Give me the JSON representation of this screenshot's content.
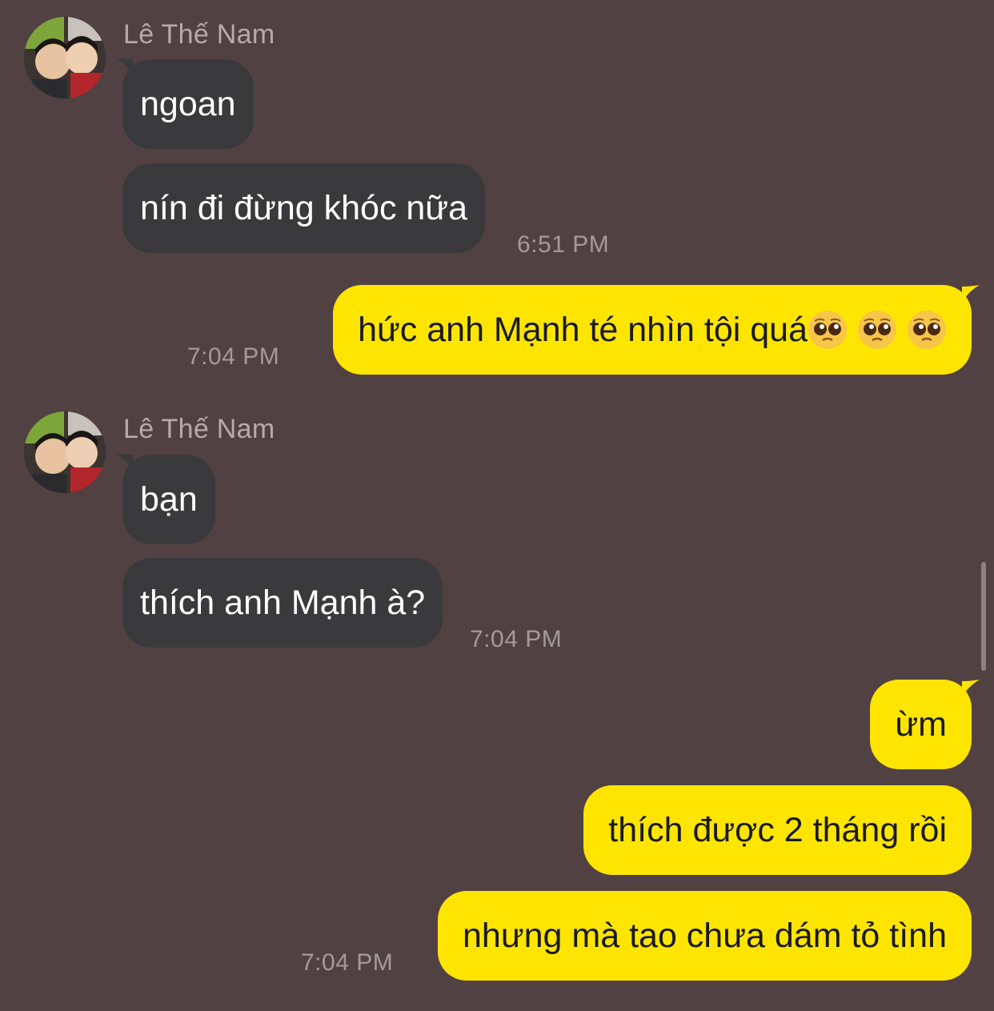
{
  "sender": {
    "name": "Lê Thế Nam"
  },
  "messages": [
    {
      "dir": "in",
      "text": "ngoan"
    },
    {
      "dir": "in",
      "text": "nín đi đừng khóc nữa",
      "time": "6:51 PM"
    },
    {
      "dir": "out",
      "text": "hức anh Mạnh té nhìn tội quá",
      "emoji": [
        "pleading-face",
        "pleading-face",
        "pleading-face"
      ],
      "time": "7:04 PM"
    },
    {
      "dir": "in",
      "text": "bạn"
    },
    {
      "dir": "in",
      "text": "thích anh Mạnh à?",
      "time": "7:04 PM"
    },
    {
      "dir": "out",
      "text": "ừm"
    },
    {
      "dir": "out",
      "text": "thích được 2 tháng rồi"
    },
    {
      "dir": "out",
      "text": "nhưng mà tao chưa dám tỏ tình",
      "time": "7:04 PM"
    }
  ],
  "colors": {
    "background": "#524142",
    "incoming_bubble": "#3a3a3c",
    "outgoing_bubble": "#fee500",
    "timestamp": "#a59a99"
  }
}
